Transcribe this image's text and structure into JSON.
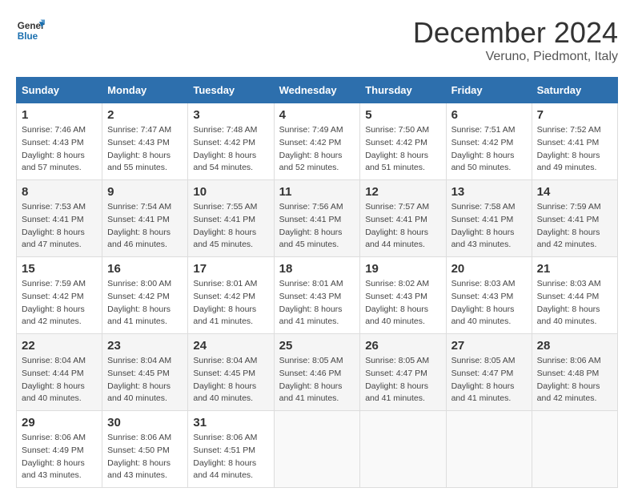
{
  "header": {
    "logo_line1": "General",
    "logo_line2": "Blue",
    "month_title": "December 2024",
    "location": "Veruno, Piedmont, Italy"
  },
  "weekdays": [
    "Sunday",
    "Monday",
    "Tuesday",
    "Wednesday",
    "Thursday",
    "Friday",
    "Saturday"
  ],
  "weeks": [
    [
      {
        "day": "1",
        "sunrise": "7:46 AM",
        "sunset": "4:43 PM",
        "daylight": "8 hours and 57 minutes."
      },
      {
        "day": "2",
        "sunrise": "7:47 AM",
        "sunset": "4:43 PM",
        "daylight": "8 hours and 55 minutes."
      },
      {
        "day": "3",
        "sunrise": "7:48 AM",
        "sunset": "4:42 PM",
        "daylight": "8 hours and 54 minutes."
      },
      {
        "day": "4",
        "sunrise": "7:49 AM",
        "sunset": "4:42 PM",
        "daylight": "8 hours and 52 minutes."
      },
      {
        "day": "5",
        "sunrise": "7:50 AM",
        "sunset": "4:42 PM",
        "daylight": "8 hours and 51 minutes."
      },
      {
        "day": "6",
        "sunrise": "7:51 AM",
        "sunset": "4:42 PM",
        "daylight": "8 hours and 50 minutes."
      },
      {
        "day": "7",
        "sunrise": "7:52 AM",
        "sunset": "4:41 PM",
        "daylight": "8 hours and 49 minutes."
      }
    ],
    [
      {
        "day": "8",
        "sunrise": "7:53 AM",
        "sunset": "4:41 PM",
        "daylight": "8 hours and 47 minutes."
      },
      {
        "day": "9",
        "sunrise": "7:54 AM",
        "sunset": "4:41 PM",
        "daylight": "8 hours and 46 minutes."
      },
      {
        "day": "10",
        "sunrise": "7:55 AM",
        "sunset": "4:41 PM",
        "daylight": "8 hours and 45 minutes."
      },
      {
        "day": "11",
        "sunrise": "7:56 AM",
        "sunset": "4:41 PM",
        "daylight": "8 hours and 45 minutes."
      },
      {
        "day": "12",
        "sunrise": "7:57 AM",
        "sunset": "4:41 PM",
        "daylight": "8 hours and 44 minutes."
      },
      {
        "day": "13",
        "sunrise": "7:58 AM",
        "sunset": "4:41 PM",
        "daylight": "8 hours and 43 minutes."
      },
      {
        "day": "14",
        "sunrise": "7:59 AM",
        "sunset": "4:41 PM",
        "daylight": "8 hours and 42 minutes."
      }
    ],
    [
      {
        "day": "15",
        "sunrise": "7:59 AM",
        "sunset": "4:42 PM",
        "daylight": "8 hours and 42 minutes."
      },
      {
        "day": "16",
        "sunrise": "8:00 AM",
        "sunset": "4:42 PM",
        "daylight": "8 hours and 41 minutes."
      },
      {
        "day": "17",
        "sunrise": "8:01 AM",
        "sunset": "4:42 PM",
        "daylight": "8 hours and 41 minutes."
      },
      {
        "day": "18",
        "sunrise": "8:01 AM",
        "sunset": "4:43 PM",
        "daylight": "8 hours and 41 minutes."
      },
      {
        "day": "19",
        "sunrise": "8:02 AM",
        "sunset": "4:43 PM",
        "daylight": "8 hours and 40 minutes."
      },
      {
        "day": "20",
        "sunrise": "8:03 AM",
        "sunset": "4:43 PM",
        "daylight": "8 hours and 40 minutes."
      },
      {
        "day": "21",
        "sunrise": "8:03 AM",
        "sunset": "4:44 PM",
        "daylight": "8 hours and 40 minutes."
      }
    ],
    [
      {
        "day": "22",
        "sunrise": "8:04 AM",
        "sunset": "4:44 PM",
        "daylight": "8 hours and 40 minutes."
      },
      {
        "day": "23",
        "sunrise": "8:04 AM",
        "sunset": "4:45 PM",
        "daylight": "8 hours and 40 minutes."
      },
      {
        "day": "24",
        "sunrise": "8:04 AM",
        "sunset": "4:45 PM",
        "daylight": "8 hours and 40 minutes."
      },
      {
        "day": "25",
        "sunrise": "8:05 AM",
        "sunset": "4:46 PM",
        "daylight": "8 hours and 41 minutes."
      },
      {
        "day": "26",
        "sunrise": "8:05 AM",
        "sunset": "4:47 PM",
        "daylight": "8 hours and 41 minutes."
      },
      {
        "day": "27",
        "sunrise": "8:05 AM",
        "sunset": "4:47 PM",
        "daylight": "8 hours and 41 minutes."
      },
      {
        "day": "28",
        "sunrise": "8:06 AM",
        "sunset": "4:48 PM",
        "daylight": "8 hours and 42 minutes."
      }
    ],
    [
      {
        "day": "29",
        "sunrise": "8:06 AM",
        "sunset": "4:49 PM",
        "daylight": "8 hours and 43 minutes."
      },
      {
        "day": "30",
        "sunrise": "8:06 AM",
        "sunset": "4:50 PM",
        "daylight": "8 hours and 43 minutes."
      },
      {
        "day": "31",
        "sunrise": "8:06 AM",
        "sunset": "4:51 PM",
        "daylight": "8 hours and 44 minutes."
      },
      null,
      null,
      null,
      null
    ]
  ]
}
